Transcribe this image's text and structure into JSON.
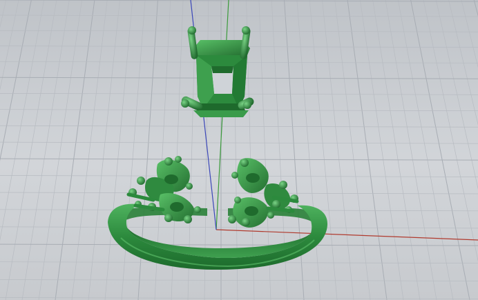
{
  "viewport": {
    "view": "perspective",
    "background_color": "#c9ccd1",
    "grid": {
      "visible": true,
      "minor_color": "#b7bbc1",
      "major_color": "#a8adb4"
    },
    "axes": {
      "x_color": "#b03a2e",
      "y_color": "#3a9a3a",
      "z_color": "#3a46b8"
    },
    "models": [
      {
        "name": "emerald-cut-head",
        "color": "#2f8a3f",
        "type": "four-prong setting"
      },
      {
        "name": "ring-shank",
        "color": "#2f8a3f",
        "type": "open shank with side settings"
      }
    ]
  }
}
